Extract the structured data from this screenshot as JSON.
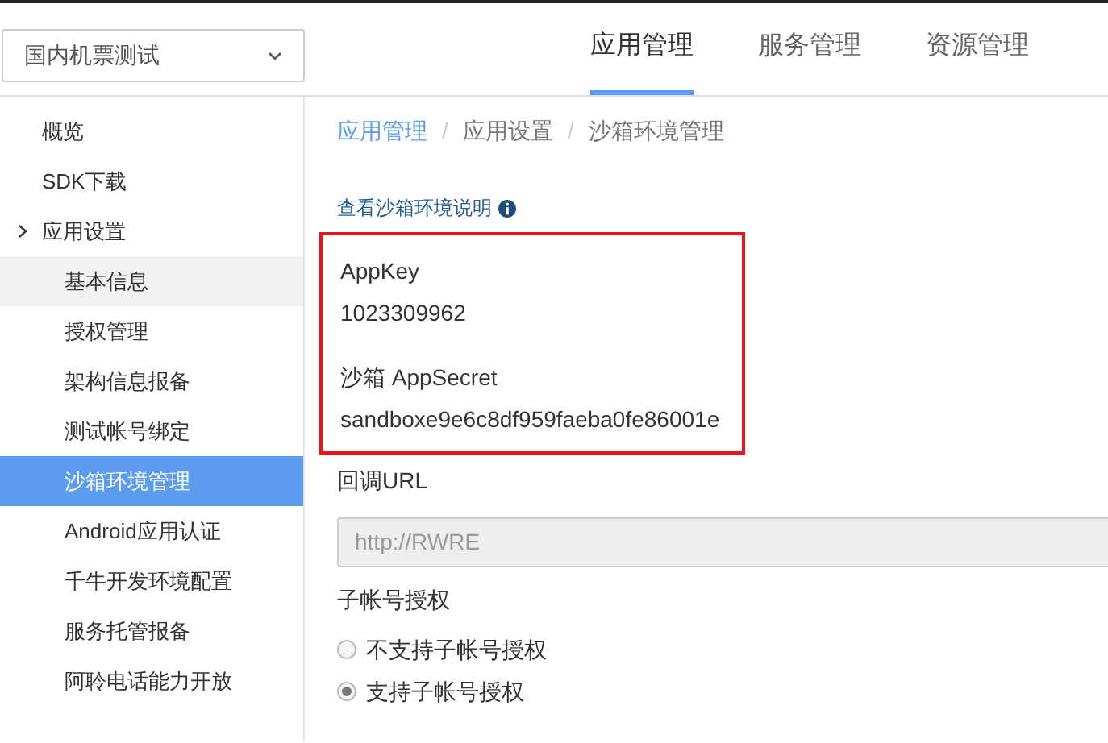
{
  "app_selector": {
    "value": "国内机票测试"
  },
  "top_nav": [
    {
      "label": "应用管理",
      "selected": true
    },
    {
      "label": "服务管理",
      "selected": false
    },
    {
      "label": "资源管理",
      "selected": false
    }
  ],
  "sidebar": {
    "items": [
      {
        "label": "概览"
      },
      {
        "label": "SDK下载"
      },
      {
        "label": "应用设置",
        "expanded": true,
        "children": [
          {
            "label": "基本信息",
            "selected": false,
            "hovered": true
          },
          {
            "label": "授权管理",
            "selected": false,
            "hovered": false
          },
          {
            "label": "架构信息报备",
            "selected": false,
            "hovered": false
          },
          {
            "label": "测试帐号绑定",
            "selected": false,
            "hovered": false
          },
          {
            "label": "沙箱环境管理",
            "selected": true,
            "hovered": false
          },
          {
            "label": "Android应用认证",
            "selected": false,
            "hovered": false
          },
          {
            "label": "千牛开发环境配置",
            "selected": false,
            "hovered": false
          },
          {
            "label": "服务托管报备",
            "selected": false,
            "hovered": false
          },
          {
            "label": "阿聆电话能力开放",
            "selected": false,
            "hovered": false
          }
        ]
      }
    ]
  },
  "breadcrumb": [
    {
      "label": "应用管理",
      "kind": "link"
    },
    {
      "label": "/",
      "kind": "separator"
    },
    {
      "label": "应用设置",
      "kind": "text"
    },
    {
      "label": "/",
      "kind": "separator"
    },
    {
      "label": "沙箱环境管理",
      "kind": "text"
    }
  ],
  "help_link": "查看沙箱环境说明",
  "credentials": [
    {
      "label": "AppKey",
      "value": "1023309962"
    },
    {
      "label": "沙箱 AppSecret",
      "value": "sandboxe9e6c8df959faeba0fe86001e"
    }
  ],
  "callback_url": {
    "label": "回调URL",
    "value": "http://RWRE",
    "disabled": true
  },
  "sub_account": {
    "label": "子帐号授权",
    "options": [
      {
        "label": "不支持子帐号授权",
        "selected": false
      },
      {
        "label": "支持子帐号授权",
        "selected": true
      }
    ]
  }
}
